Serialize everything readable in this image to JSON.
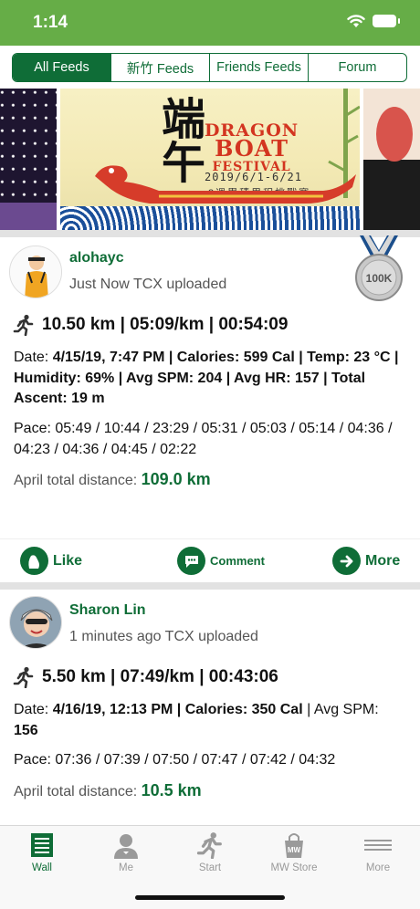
{
  "status_bar": {
    "time": "1:14"
  },
  "feed_tabs": [
    {
      "label": "All Feeds",
      "active": true
    },
    {
      "label": "新竹 Feeds",
      "active": false
    },
    {
      "label": "Friends Feeds",
      "active": false
    },
    {
      "label": "Forum",
      "active": false
    }
  ],
  "banner": {
    "title_line1": "DRAGON",
    "title_line2": "BOAT",
    "title_line3": "FESTIVAL",
    "date": "2019/6/1-6/21",
    "subtitle": "3週累積里程挑戰賽"
  },
  "posts": [
    {
      "username": "alohayc",
      "upload_info": "Just Now TCX uploaded",
      "badge": "100K",
      "summary": "10.50 km | 05:09/km | 00:54:09",
      "details": {
        "date_label": "Date: ",
        "date": "4/15/19, 7:47 PM",
        "calories_label": " | Calories: ",
        "calories": "599 Cal",
        "temp_label": " | Temp: ",
        "temp": "23 °C",
        "humidity_label": " | Humidity: ",
        "humidity": "69%",
        "spm_label": " | Avg SPM: ",
        "spm": "204",
        "hr_label": " | Avg HR: ",
        "hr": "157",
        "ascent_label": " | Total Ascent: ",
        "ascent": "19 m"
      },
      "pace": "Pace: 05:49 / 10:44 / 23:29 / 05:31 / 05:03 / 05:14 / 04:36 / 04:23 / 04:36 / 04:45 / 02:22",
      "month_label": "April total distance: ",
      "month_total": "109.0 km"
    },
    {
      "username": "Sharon Lin",
      "upload_info": "1 minutes ago TCX uploaded",
      "summary": "5.50 km | 07:49/km | 00:43:06",
      "details": {
        "date_label": "Date: ",
        "date": "4/16/19, 12:13 PM",
        "calories_label": " | Calories: ",
        "calories": "350 Cal",
        "spm_label": " | Avg SPM: ",
        "spm": "156"
      },
      "pace": "Pace: 07:36 / 07:39 / 07:50 / 07:47 / 07:42 / 04:32",
      "month_label": "April total distance: ",
      "month_total": "10.5 km"
    }
  ],
  "actions": {
    "like": "Like",
    "comment": "Comment",
    "more": "More"
  },
  "tab_bar": [
    {
      "label": "Wall",
      "icon": "wall-icon",
      "active": true
    },
    {
      "label": "Me",
      "icon": "profile-icon",
      "active": false
    },
    {
      "label": "Start",
      "icon": "runner-icon",
      "active": false
    },
    {
      "label": "MW Store",
      "icon": "shopping-bag-icon",
      "active": false
    },
    {
      "label": "More",
      "icon": "menu-lines-icon",
      "active": false
    }
  ],
  "colors": {
    "brand_green": "#0f6d37",
    "status_green": "#66ad47"
  }
}
